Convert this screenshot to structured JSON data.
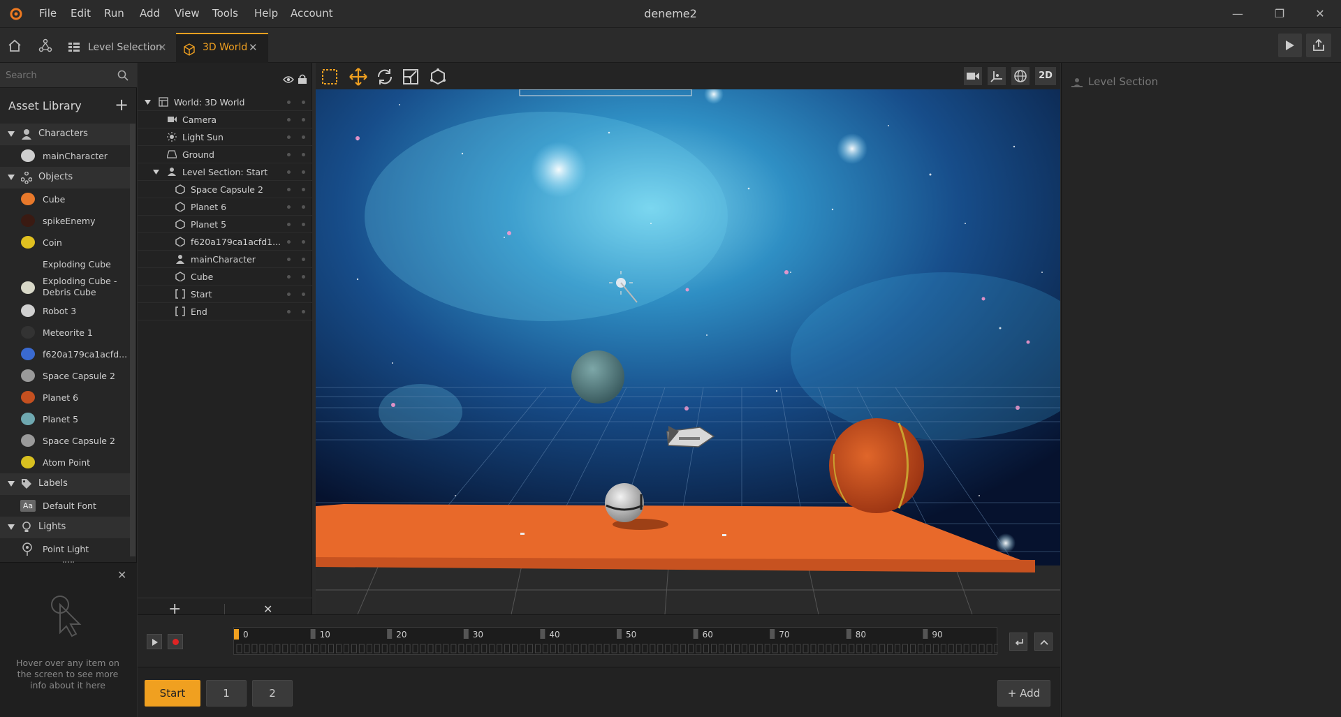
{
  "app": {
    "title": "deneme2"
  },
  "menu": [
    "File",
    "Edit",
    "Run",
    "Add",
    "View",
    "Tools",
    "Help",
    "Account"
  ],
  "tabs": [
    {
      "label": "Level Selection"
    },
    {
      "label": "3D World"
    }
  ],
  "left": {
    "search_placeholder": "Search",
    "asset_library_title": "Asset Library",
    "groups": [
      {
        "name": "Characters",
        "items": [
          {
            "label": "mainCharacter",
            "color": "#cfcfcf"
          }
        ]
      },
      {
        "name": "Objects",
        "items": [
          {
            "label": "Cube",
            "color": "#e8792b"
          },
          {
            "label": "spikeEnemy",
            "color": "#3a1a12"
          },
          {
            "label": "Coin",
            "color": "#e0c020"
          },
          {
            "label": "Exploding Cube",
            "color": ""
          },
          {
            "label": "Exploding Cube - Debris Cube",
            "color": "#d8d8c8"
          },
          {
            "label": "Robot 3",
            "color": "#d0d0d0"
          },
          {
            "label": "Meteorite 1",
            "color": "#333333"
          },
          {
            "label": "f620a179ca1acfd...",
            "color": "#3a6ad0"
          },
          {
            "label": "Space Capsule 2",
            "color": "#9a9a9a"
          },
          {
            "label": "Planet 6",
            "color": "#c45020"
          },
          {
            "label": "Planet 5",
            "color": "#6fa8b0"
          },
          {
            "label": "Space Capsule 2",
            "color": "#9a9a9a"
          },
          {
            "label": "Atom Point",
            "color": "#d8c020"
          }
        ]
      },
      {
        "name": "Labels",
        "items": [
          {
            "label": "Default Font",
            "color": "#666666"
          }
        ]
      },
      {
        "name": "Lights",
        "items": [
          {
            "label": "Point Light",
            "color": ""
          }
        ]
      }
    ],
    "info_text": "Hover over any item on the screen to see more info about it here"
  },
  "hierarchy": {
    "rows": [
      {
        "label": "World: 3D World",
        "icon": "world-icon",
        "indent": 0,
        "arrow": true
      },
      {
        "label": "Camera",
        "icon": "camera-icon",
        "indent": 1,
        "arrow": false
      },
      {
        "label": "Light Sun",
        "icon": "sun-icon",
        "indent": 1,
        "arrow": false
      },
      {
        "label": "Ground",
        "icon": "ground-icon",
        "indent": 1,
        "arrow": false
      },
      {
        "label": "Level Section: Start",
        "icon": "level-section-icon",
        "indent": 1,
        "arrow": true
      },
      {
        "label": "Space Capsule 2",
        "icon": "object-icon",
        "indent": 2,
        "arrow": false
      },
      {
        "label": "Planet 6",
        "icon": "object-icon",
        "indent": 2,
        "arrow": false
      },
      {
        "label": "Planet 5",
        "icon": "object-icon",
        "indent": 2,
        "arrow": false
      },
      {
        "label": "f620a179ca1acfd1...",
        "icon": "object-icon",
        "indent": 2,
        "arrow": false
      },
      {
        "label": "mainCharacter",
        "icon": "character-icon",
        "indent": 2,
        "arrow": false
      },
      {
        "label": "Cube",
        "icon": "object-icon",
        "indent": 2,
        "arrow": false
      },
      {
        "label": "Start",
        "icon": "bracket-icon",
        "indent": 2,
        "arrow": false
      },
      {
        "label": "End",
        "icon": "bracket-icon",
        "indent": 2,
        "arrow": false
      }
    ]
  },
  "viewport": {
    "mode_2d_label": "2D"
  },
  "right_panel": {
    "title": "Level Section"
  },
  "timeline": {
    "ticks": [
      "0",
      "10",
      "20",
      "30",
      "40",
      "50",
      "60",
      "70",
      "80",
      "90"
    ]
  },
  "sections": [
    {
      "label": "Start",
      "active": true
    },
    {
      "label": "1",
      "active": false
    },
    {
      "label": "2",
      "active": false
    }
  ],
  "add_button": {
    "label": "Add"
  },
  "colors": {
    "accent": "#f0a020",
    "ground": "#e8692a"
  }
}
